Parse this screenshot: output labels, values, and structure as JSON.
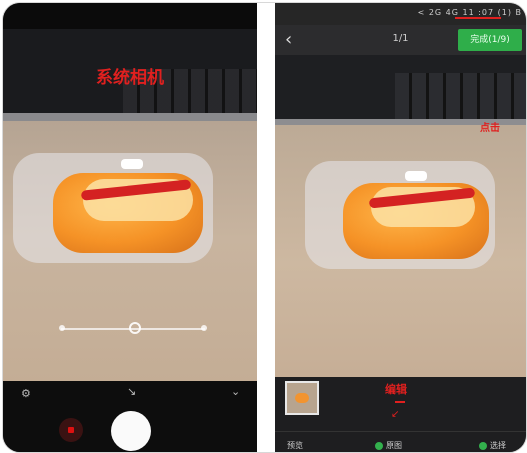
{
  "left_phone": {
    "title": "系统相机",
    "title_color": "#e0201f",
    "product_label": "",
    "bottom_icons": [
      "flash-icon",
      "switch-camera-icon",
      "menu-chevron-icon"
    ]
  },
  "right_phone": {
    "status_bar_text": "< 2G 4G 11 :07 (1) B",
    "page_indicator": "1/1",
    "confirm_button": "完成(1/9)",
    "click_note": "点击",
    "edit_note": "编辑",
    "edit_arrow": "↙",
    "bottom_left": "预览",
    "bottom_mid": "原图",
    "bottom_right": "选择",
    "accent": "#2fae4a"
  }
}
